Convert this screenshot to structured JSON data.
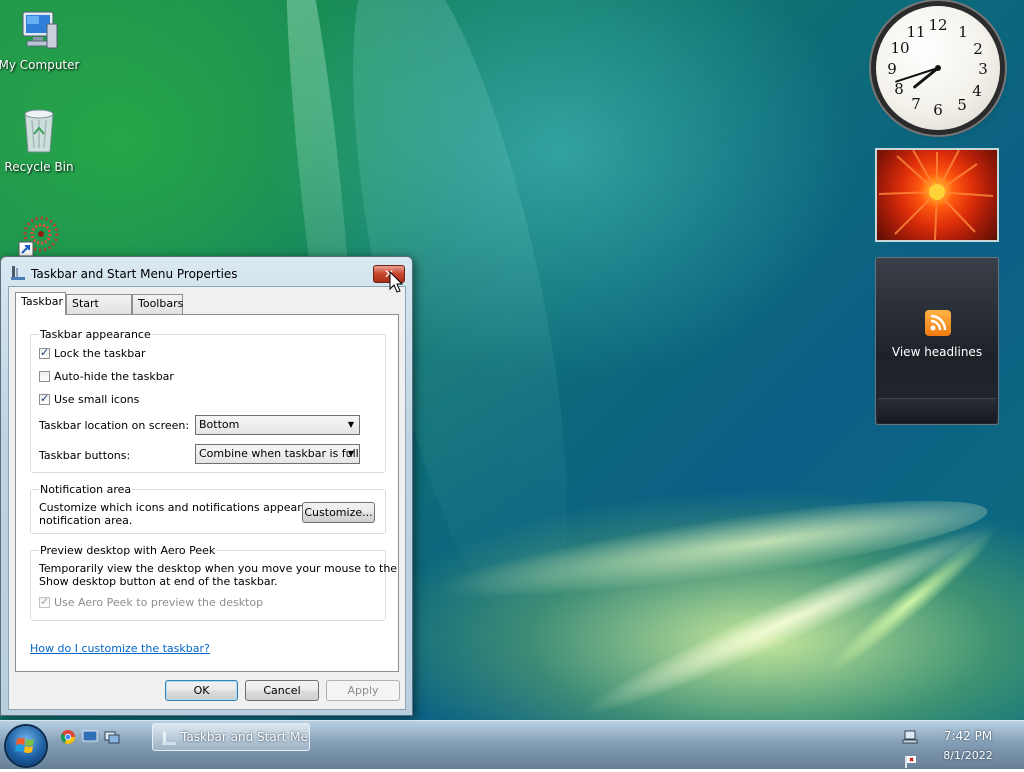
{
  "desktop": {
    "icons": [
      {
        "label": "My Computer"
      },
      {
        "label": "Recycle Bin"
      }
    ]
  },
  "gadgets": {
    "clock": {
      "numbers": [
        "12",
        "1",
        "2",
        "3",
        "4",
        "5",
        "6",
        "7",
        "8",
        "9",
        "10",
        "11"
      ],
      "time": "7:42"
    },
    "feed": {
      "label": "View headlines"
    }
  },
  "dialog": {
    "title": "Taskbar and Start Menu Properties",
    "close_label": "✕",
    "tabs": [
      "Taskbar",
      "Start Menu",
      "Toolbars"
    ],
    "appearance": {
      "title": "Taskbar appearance",
      "lock": {
        "label": "Lock the taskbar",
        "checked": true
      },
      "autohide": {
        "label": "Auto-hide the taskbar",
        "checked": false
      },
      "small_icons": {
        "label": "Use small icons",
        "checked": true
      },
      "location_label": "Taskbar location on screen:",
      "location_value": "Bottom",
      "buttons_label": "Taskbar buttons:",
      "buttons_value": "Combine when taskbar is full"
    },
    "notification": {
      "title": "Notification area",
      "text_line1": "Customize which icons and notifications appear in the",
      "text_line2": "notification area.",
      "customize_label": "Customize..."
    },
    "aero": {
      "title": "Preview desktop with Aero Peek",
      "text_line1": "Temporarily view the desktop when you move your mouse to the",
      "text_line2": "Show desktop button at end of the taskbar.",
      "checkbox_label": "Use Aero Peek to preview the desktop",
      "checked": true,
      "disabled": true
    },
    "help_link": "How do I customize the taskbar?",
    "buttons": {
      "ok": "OK",
      "cancel": "Cancel",
      "apply": "Apply"
    }
  },
  "taskbar": {
    "task_label": "Taskbar and Start Me...",
    "time": "7:42 PM",
    "date": "8/1/2022"
  },
  "colors": {
    "link": "#0066cc",
    "close": "#c8452d",
    "taskbar": "#6f8aa3"
  }
}
